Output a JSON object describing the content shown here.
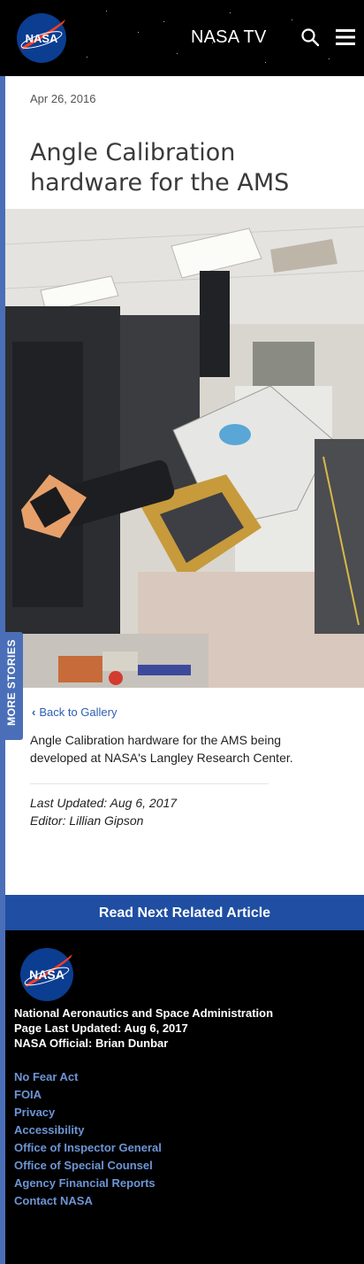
{
  "header": {
    "logo_text": "NASA",
    "nav_title": "NASA TV",
    "search_icon": "search-icon",
    "menu_icon": "menu-icon"
  },
  "article": {
    "date": "Apr 26, 2016",
    "title": "Angle Calibration hardware for the AMS",
    "back_label": "Back to Gallery",
    "caption": "Angle Calibration hardware for the AMS being developed at NASA's Langley Research Center.",
    "last_updated": "Last Updated: Aug 6, 2017",
    "editor": "Editor: Lillian Gipson"
  },
  "side_tab": {
    "label": "MORE STORIES"
  },
  "read_next": {
    "label": "Read Next Related Article"
  },
  "footer": {
    "logo_text": "NASA",
    "org": "National Aeronautics and Space Administration",
    "page_updated": "Page Last Updated: Aug 6, 2017",
    "official": "NASA Official: Brian Dunbar",
    "links": [
      "No Fear Act",
      "FOIA",
      "Privacy",
      "Accessibility",
      "Office of Inspector General",
      "Office of Special Counsel",
      "Agency Financial Reports",
      "Contact NASA"
    ]
  },
  "colors": {
    "accent": "#4a6fb8",
    "readnext_bg": "#1f4ea3",
    "link": "#6d95d6",
    "nasa_blue": "#0b3d91",
    "nasa_red": "#fc3d21"
  }
}
